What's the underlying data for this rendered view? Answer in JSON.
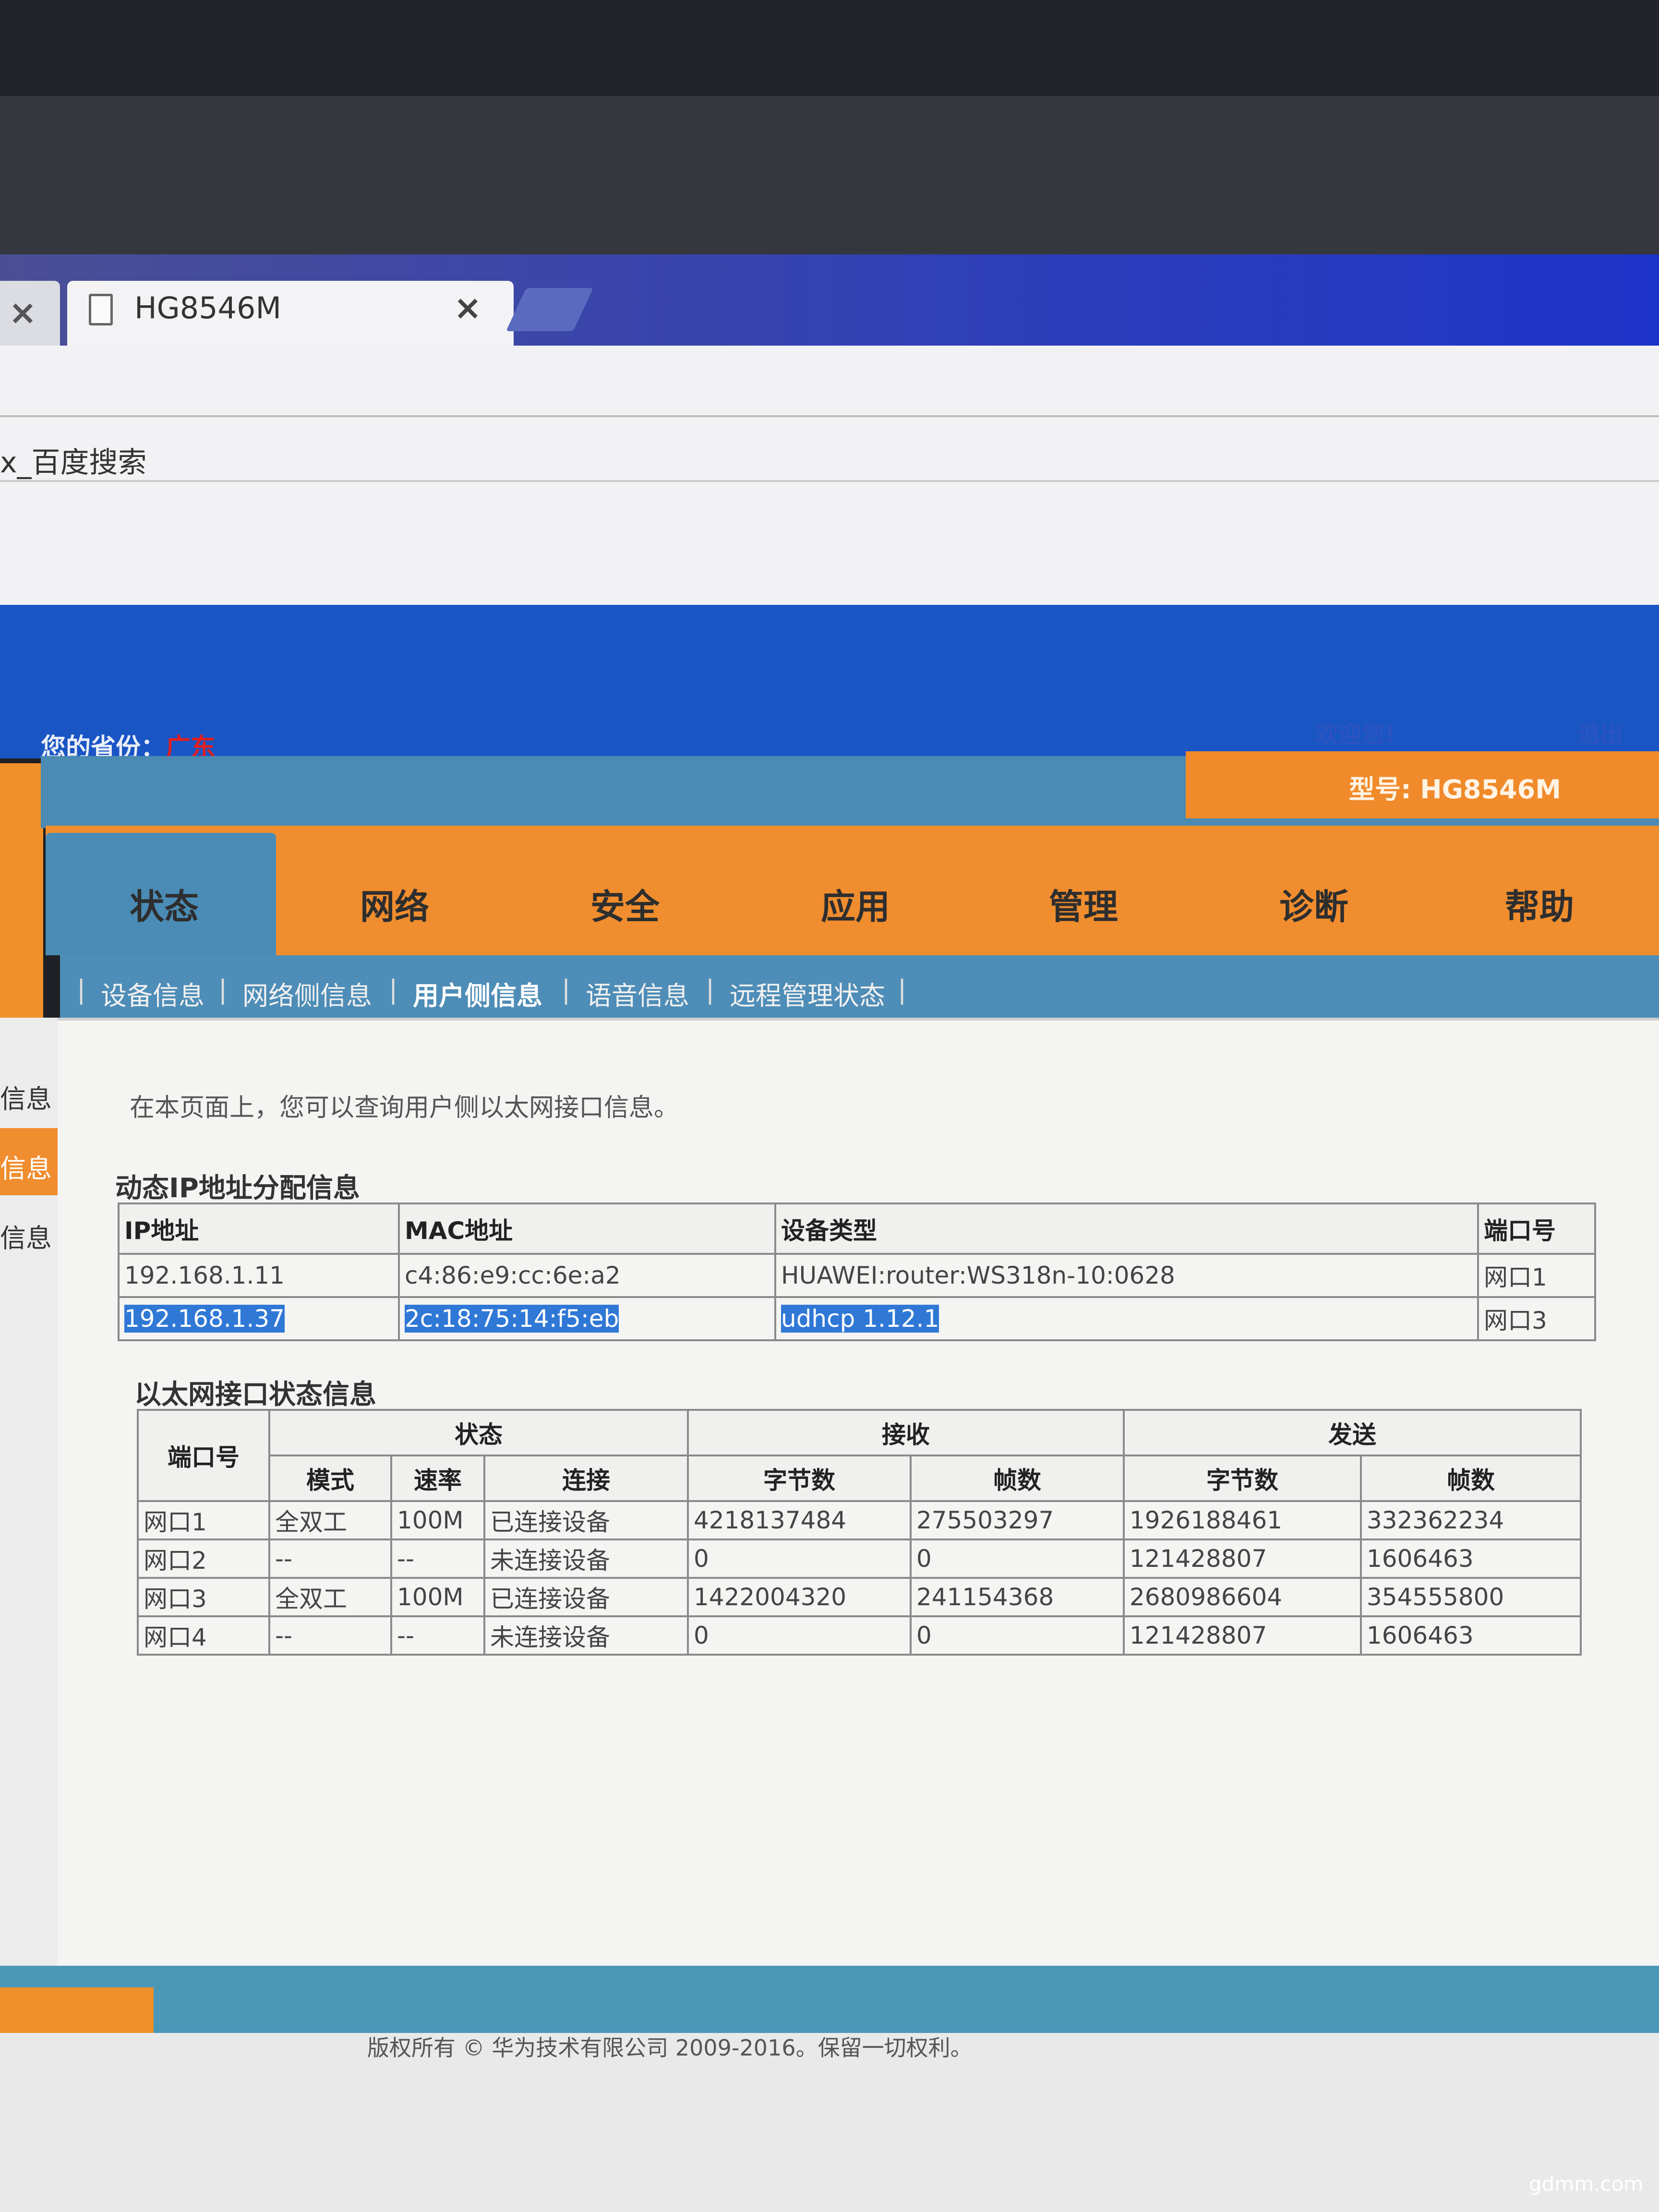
{
  "browser": {
    "prev_tab_close": "×",
    "tab_title": "HG8546M",
    "tab_close": "×",
    "search_text": "x_百度搜索"
  },
  "header": {
    "province_label": "您的省份：",
    "province_value": "广东",
    "welcome": "欢迎您!",
    "logout": "退出",
    "model": "型号: HG8546M"
  },
  "nav": {
    "items": [
      "状态",
      "网络",
      "安全",
      "应用",
      "管理",
      "诊断",
      "帮助"
    ],
    "active": "状态"
  },
  "subnav": {
    "items": [
      "设备信息",
      "网络侧信息",
      "用户侧信息",
      "语音信息",
      "远程管理状态"
    ],
    "active": "用户侧信息"
  },
  "sidebar": {
    "items": [
      "信息",
      "信息",
      "信息"
    ],
    "active_index": 1
  },
  "content": {
    "description": "在本页面上，您可以查询用户侧以太网接口信息。",
    "dhcp_title": "动态IP地址分配信息",
    "dhcp_headers": [
      "IP地址",
      "MAC地址",
      "设备类型",
      "端口号"
    ],
    "dhcp_rows": [
      [
        "192.168.1.11",
        "c4:86:e9:cc:6e:a2",
        "HUAWEI:router:WS318n-10:0628",
        "网口1"
      ],
      [
        "192.168.1.37",
        "2c:18:75:14:f5:eb",
        "udhcp 1.12.1",
        "网口3"
      ]
    ],
    "eth_title": "以太网接口状态信息",
    "eth_group_headers": [
      "端口号",
      "状态",
      "接收",
      "发送"
    ],
    "eth_sub_headers": [
      "模式",
      "速率",
      "连接",
      "字节数",
      "帧数",
      "字节数",
      "帧数"
    ],
    "eth_rows": [
      [
        "网口1",
        "全双工",
        "100M",
        "已连接设备",
        "4218137484",
        "275503297",
        "1926188461",
        "332362234"
      ],
      [
        "网口2",
        "--",
        "--",
        "未连接设备",
        "0",
        "0",
        "121428807",
        "1606463"
      ],
      [
        "网口3",
        "全双工",
        "100M",
        "已连接设备",
        "1422004320",
        "241154368",
        "2680986604",
        "354555800"
      ],
      [
        "网口4",
        "--",
        "--",
        "未连接设备",
        "0",
        "0",
        "121428807",
        "1606463"
      ]
    ]
  },
  "footer": {
    "copyright": "版权所有 © 华为技术有限公司 2009-2016。保留一切权利。",
    "watermark": "gdmm.com"
  },
  "colors": {
    "orange": "#f08d2e",
    "steel_blue": "#4a8cb6",
    "header_blue": "#1a55c4",
    "selection": "#2f78d6"
  }
}
